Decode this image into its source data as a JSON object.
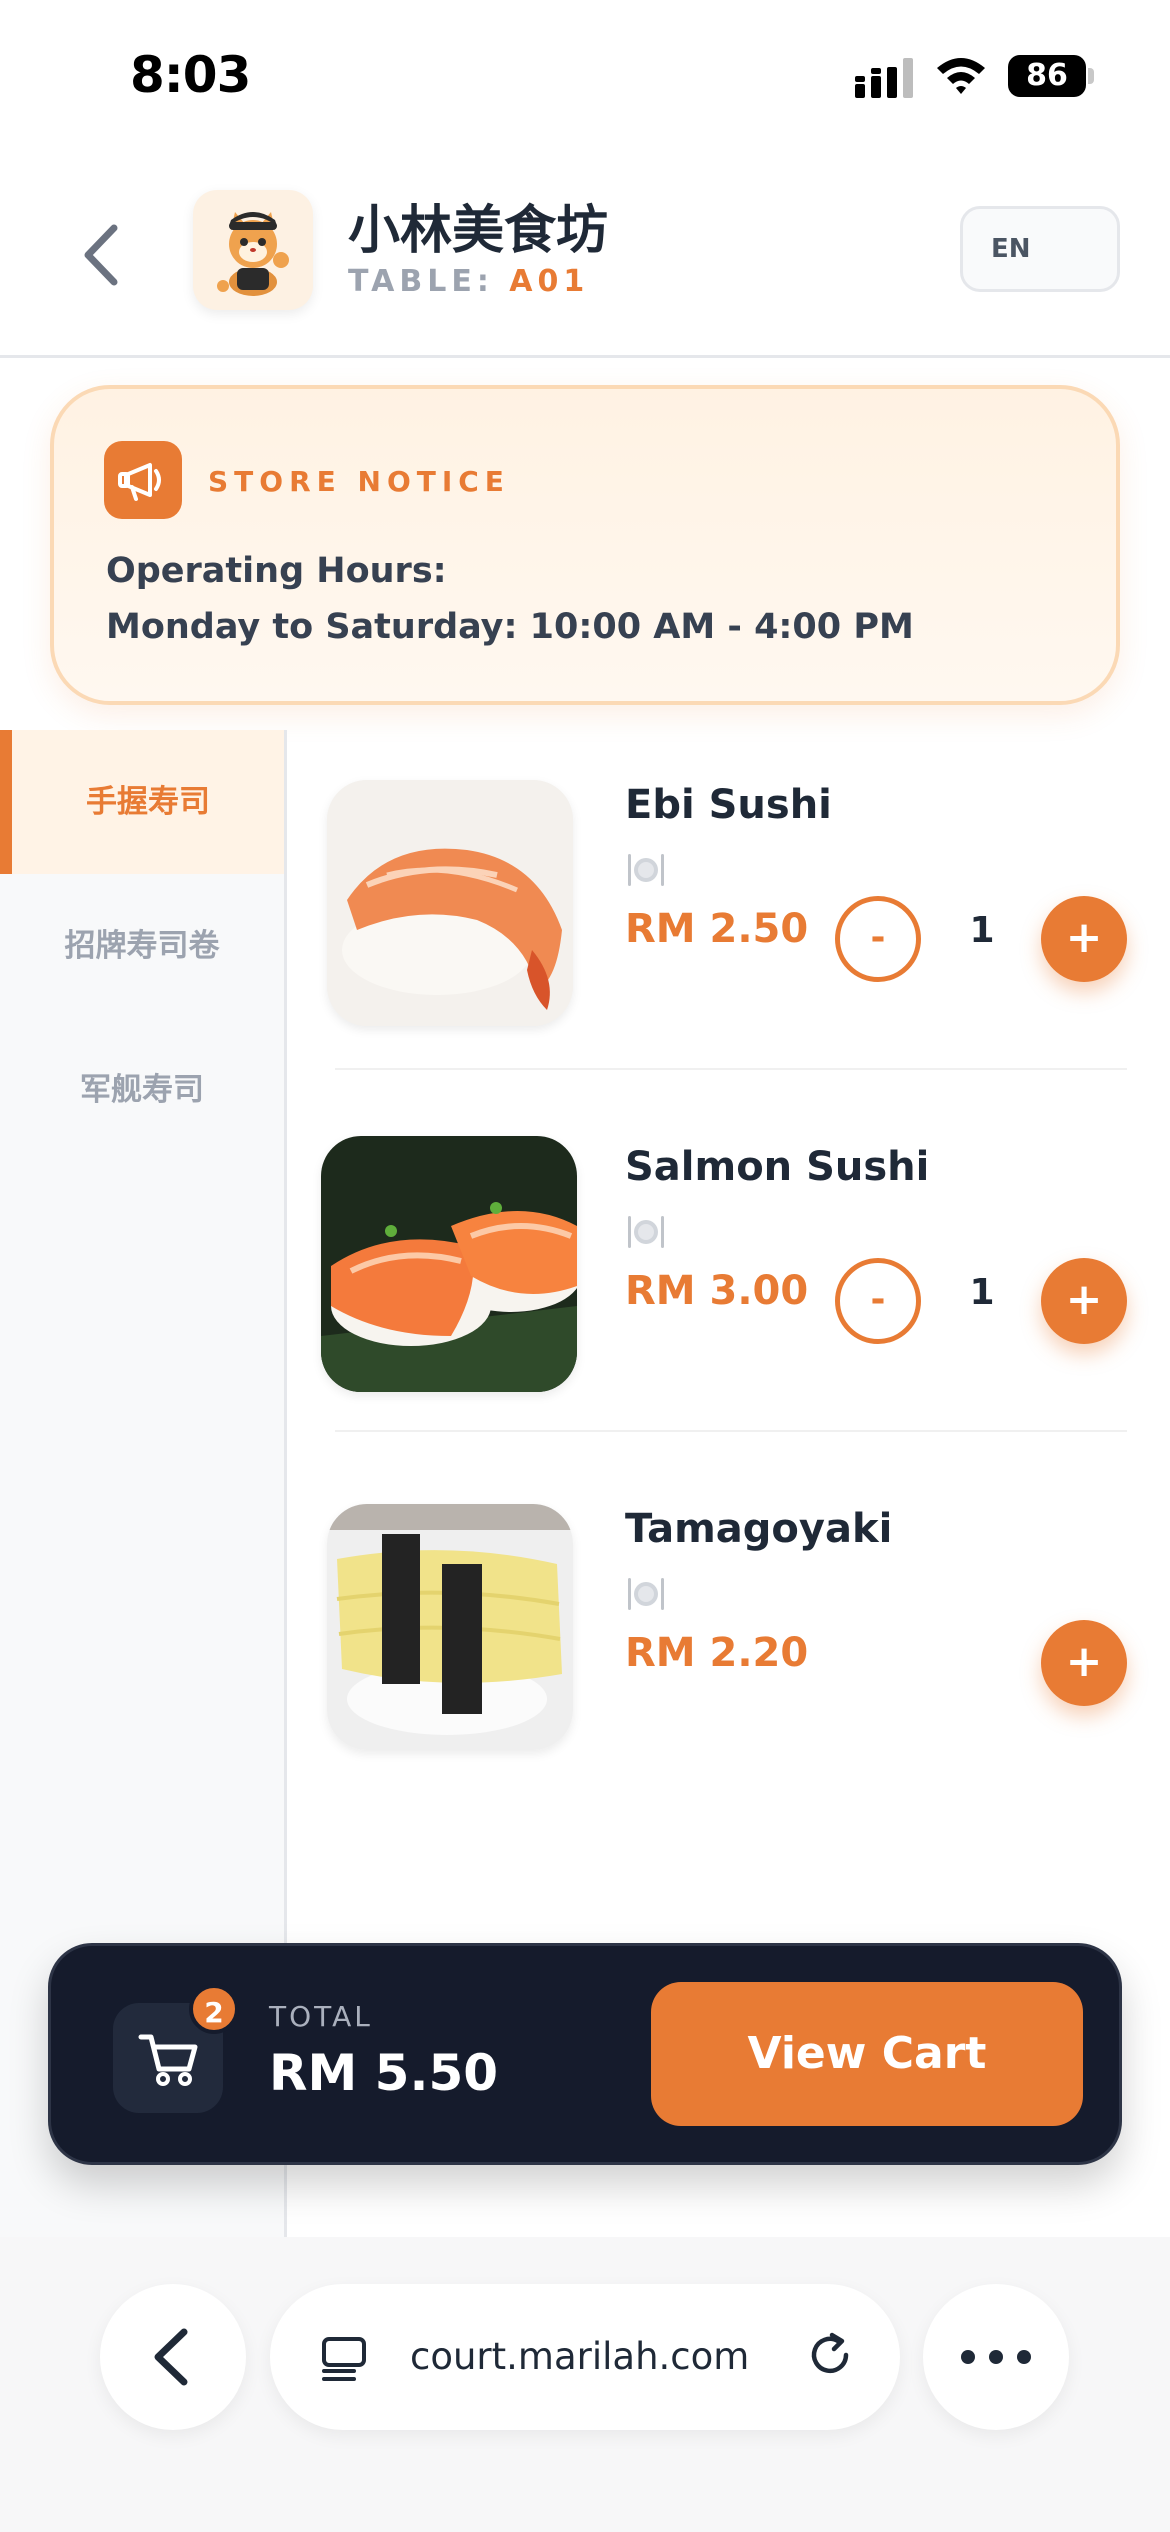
{
  "status_bar": {
    "time": "8:03",
    "battery": "86"
  },
  "header": {
    "store_name": "小林美食坊",
    "table_label": "TABLE:",
    "table_value": "A01",
    "language": "EN"
  },
  "notice": {
    "title": "STORE NOTICE",
    "line1": "Operating Hours:",
    "line2": "Monday to Saturday: 10:00 AM - 4:00 PM"
  },
  "categories": [
    {
      "label": "手握寿司",
      "active": true
    },
    {
      "label": "招牌寿司卷",
      "active": false
    },
    {
      "label": "军舰寿司",
      "active": false
    }
  ],
  "menu_items": [
    {
      "name": "Ebi Sushi",
      "price": "RM 2.50",
      "quantity": "1",
      "minus": "-",
      "plus": "+"
    },
    {
      "name": "Salmon Sushi",
      "price": "RM 3.00",
      "quantity": "1",
      "minus": "-",
      "plus": "+"
    },
    {
      "name": "Tamagoyaki",
      "price": "RM 2.20",
      "plus": "+"
    }
  ],
  "cart": {
    "badge_count": "2",
    "total_label": "TOTAL",
    "total_value": "RM 5.50",
    "button_label": "View Cart"
  },
  "browser": {
    "url": "court.marilah.com"
  },
  "colors": {
    "accent": "#e87b34",
    "dark": "#151b2c"
  },
  "icons": {
    "status": [
      "signal-icon",
      "wifi-icon",
      "battery-icon"
    ],
    "header": [
      "back-chevron-icon"
    ],
    "notice": "megaphone-icon",
    "item": "utensils-icon",
    "cart": "shopping-cart-icon",
    "browser": [
      "back-chevron-icon",
      "tabs-icon",
      "reload-icon",
      "more-icon"
    ]
  }
}
